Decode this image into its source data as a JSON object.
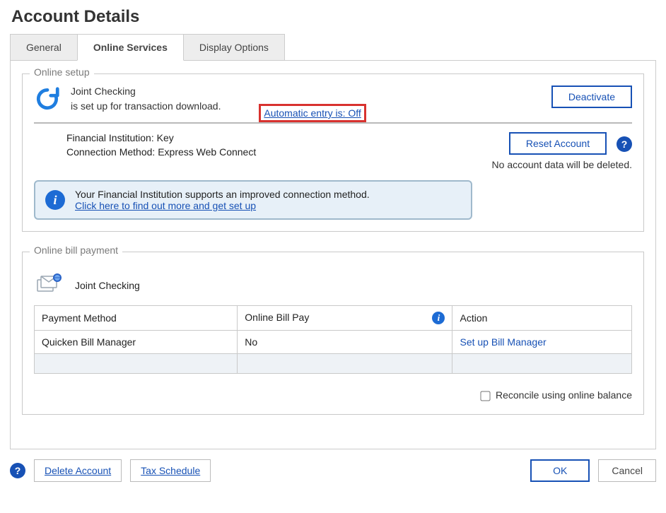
{
  "title": "Account Details",
  "tabs": {
    "general": "General",
    "online_services": "Online Services",
    "display_options": "Display Options"
  },
  "online_setup": {
    "legend": "Online setup",
    "account_name": "Joint Checking",
    "status_line": "is set up for transaction download.",
    "auto_entry": "Automatic entry is: Off",
    "deactivate": "Deactivate",
    "fi_label": "Financial Institution:",
    "fi_value": "Key",
    "cm_label": "Connection Method:",
    "cm_value": "Express Web Connect",
    "reset": "Reset Account",
    "reset_note": "No account data will be deleted.",
    "banner_line1": "Your Financial Institution supports an improved connection method.",
    "banner_link": "Click here to find out more and get set up"
  },
  "bill_payment": {
    "legend": "Online bill payment",
    "account_name": "Joint Checking",
    "columns": {
      "method": "Payment Method",
      "obp": "Online Bill Pay",
      "action": "Action"
    },
    "rows": [
      {
        "method": "Quicken Bill Manager",
        "obp": "No",
        "action": "Set up Bill Manager"
      }
    ],
    "reconcile": "Reconcile using online balance"
  },
  "footer": {
    "delete": "Delete Account",
    "tax": "Tax Schedule",
    "ok": "OK",
    "cancel": "Cancel"
  }
}
